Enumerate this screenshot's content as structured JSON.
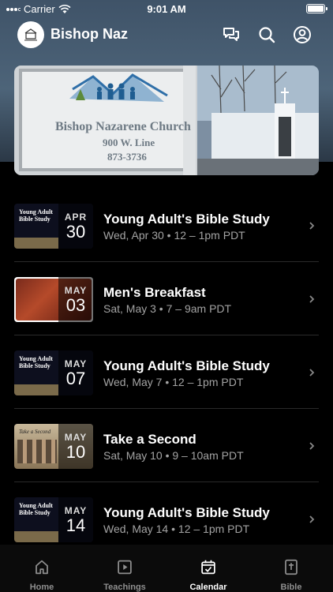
{
  "status_bar": {
    "carrier": "Carrier",
    "time": "9:01 AM"
  },
  "header": {
    "church_name": "Bishop Naz"
  },
  "hero": {
    "sign_line1": "Bishop Nazarene Church",
    "sign_line2": "900 W. Line",
    "sign_line3": "873-3736"
  },
  "events": [
    {
      "title": "Young Adult's Bible Study",
      "time": "Wed, Apr 30 • 12 – 1pm PDT",
      "month": "APR",
      "day": "30",
      "thumb_text": "Young Adult Bible Study"
    },
    {
      "title": "Men's Breakfast",
      "time": "Sat, May 3 • 7 – 9am PDT",
      "month": "MAY",
      "day": "03",
      "thumb_text": ""
    },
    {
      "title": "Young Adult's Bible Study",
      "time": "Wed, May 7 • 12 – 1pm PDT",
      "month": "MAY",
      "day": "07",
      "thumb_text": "Young Adult Bible Study"
    },
    {
      "title": "Take a Second",
      "time": "Sat, May 10 • 9 – 10am PDT",
      "month": "MAY",
      "day": "10",
      "thumb_text": "Take a Second"
    },
    {
      "title": "Young Adult's Bible Study",
      "time": "Wed, May 14 • 12 – 1pm PDT",
      "month": "MAY",
      "day": "14",
      "thumb_text": "Young Adult Bible Study"
    }
  ],
  "tabs": [
    {
      "label": "Home",
      "icon": "home-icon",
      "active": false
    },
    {
      "label": "Teachings",
      "icon": "play-icon",
      "active": false
    },
    {
      "label": "Calendar",
      "icon": "calendar-icon",
      "active": true
    },
    {
      "label": "Bible",
      "icon": "bible-icon",
      "active": false
    }
  ]
}
